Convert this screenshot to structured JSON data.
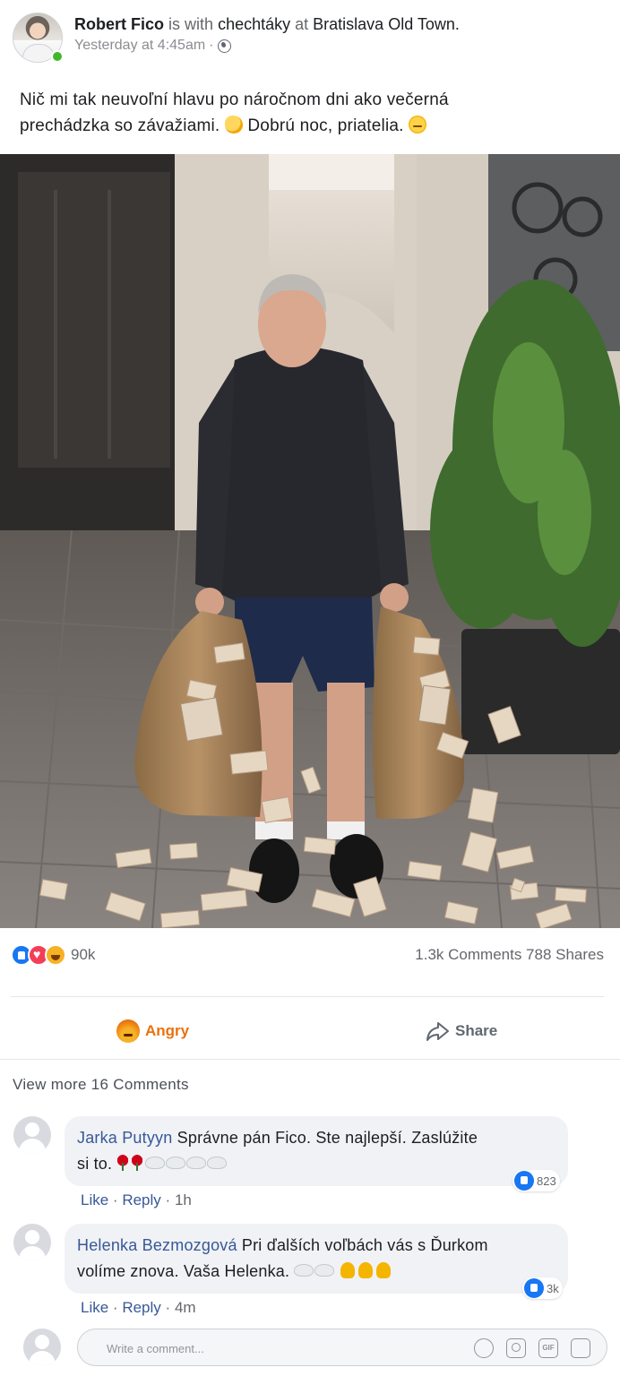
{
  "post": {
    "author": "Robert Fico",
    "with_text": "is with",
    "tagged": "chechtáky",
    "at_text": "at",
    "location": "Bratislava Old Town.",
    "time": "Yesterday at 4:45am",
    "separator": "·",
    "privacy_icon": "globe-icon",
    "text_line1": "Nič mi tak neuvoľní hlavu po náročnom dni ako večerná",
    "text_line2_a": "prechádzka so závažiami.",
    "text_line2_b": "Dobrú noc, priatelia.",
    "photo": {
      "money_note": "€"
    }
  },
  "stats": {
    "reactions": "90k",
    "comments_shares": "1.3k Comments 788 Shares"
  },
  "actions": {
    "angry_label": "Angry",
    "share_label": "Share"
  },
  "comments_section": {
    "view_more": "View more 16 Comments",
    "like_label": "Like",
    "dot": "·",
    "reply_label": "Reply",
    "items": [
      {
        "name": "Jarka Putyyn",
        "text_a": "Správne pán Fico. Ste najlepší. Zaslúžite",
        "text_b": "si to.",
        "likes": "823",
        "time": "1h"
      },
      {
        "name": "Helenka Bezmozgová",
        "text_a": "Pri ďalších voľbách vás s Ďurkom",
        "text_b": "volíme znova. Vaša Helenka.",
        "likes": "3k",
        "time": "4m"
      }
    ]
  },
  "composer": {
    "placeholder": "Write a comment..."
  },
  "colors": {
    "link": "#385898",
    "angry": "#e9710f",
    "like_blue": "#1877f2",
    "online": "#42b72a"
  }
}
